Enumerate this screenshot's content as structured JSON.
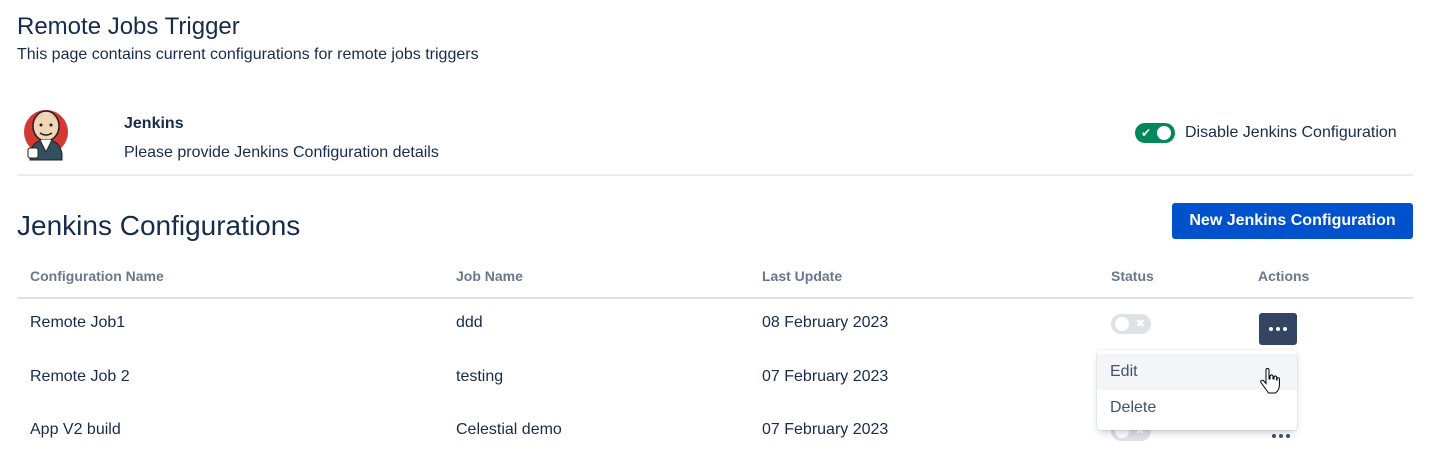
{
  "page": {
    "title": "Remote Jobs Trigger",
    "subtitle": "This page contains current configurations for remote jobs triggers"
  },
  "plugin": {
    "name": "Jenkins",
    "description": "Please provide Jenkins Configuration details",
    "logo_icon": "jenkins-butler-icon",
    "toggle_label": "Disable Jenkins Configuration",
    "toggle_on": true
  },
  "configs": {
    "title": "Jenkins Configurations",
    "new_button_label": "New Jenkins Configuration",
    "columns": {
      "name": "Configuration Name",
      "job": "Job Name",
      "updated": "Last Update",
      "status": "Status",
      "actions": "Actions"
    },
    "rows": [
      {
        "name": "Remote Job1",
        "job": "ddd",
        "updated": "08 February 2023",
        "enabled": false
      },
      {
        "name": "Remote Job 2",
        "job": "testing",
        "updated": "07 February 2023",
        "enabled": false
      },
      {
        "name": "App V2 build",
        "job": "Celestial demo",
        "updated": "07 February 2023",
        "enabled": false
      }
    ]
  },
  "menu": {
    "items": [
      "Edit",
      "Delete"
    ]
  },
  "colors": {
    "primary": "#0052cc",
    "toggle_on": "#00875a",
    "toggle_off": "#dfe1e6",
    "active_action": "#344563",
    "text": "#172b4d",
    "muted": "#6b778c"
  }
}
